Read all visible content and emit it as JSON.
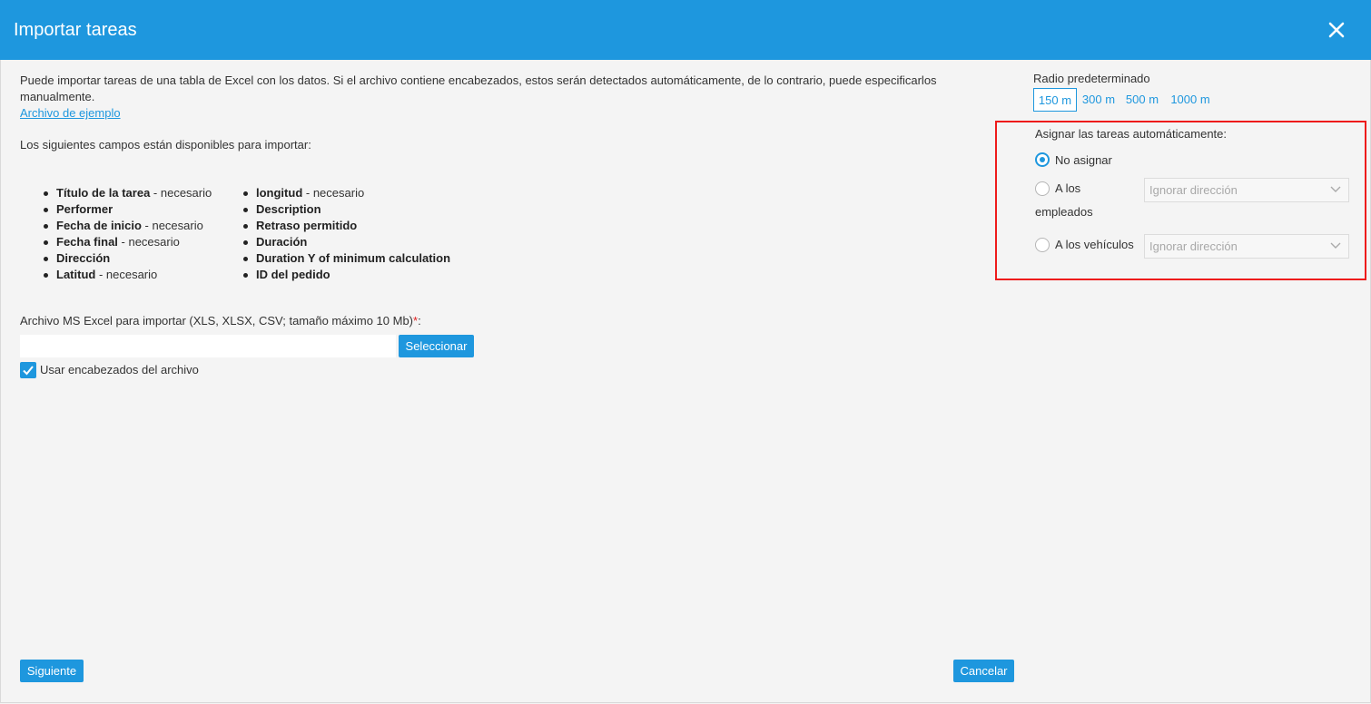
{
  "dialog": {
    "title": "Importar tareas"
  },
  "intro": {
    "text": "Puede importar tareas de una tabla de Excel con los datos. Si el archivo contiene encabezados, estos serán detectados automáticamente, de lo contrario, puede especificarlos manualmente.",
    "example_link": "Archivo de ejemplo"
  },
  "fields_title": "Los siguientes campos están disponibles para importar:",
  "fields": {
    "col1": [
      {
        "name": "Título de la tarea",
        "note": " - necesario"
      },
      {
        "name": "Performer",
        "note": ""
      },
      {
        "name": "Fecha de inicio",
        "note": " - necesario"
      },
      {
        "name": "Fecha final",
        "note": " - necesario"
      },
      {
        "name": "Dirección",
        "note": ""
      },
      {
        "name": "Latitud",
        "note": " - necesario"
      }
    ],
    "col2": [
      {
        "name": "longitud",
        "note": " - necesario"
      },
      {
        "name": "Description",
        "note": ""
      },
      {
        "name": "Retraso permitido",
        "note": ""
      },
      {
        "name": "Duración",
        "note": ""
      },
      {
        "name": "Duration Y of minimum calculation",
        "note": ""
      },
      {
        "name": "ID del pedido",
        "note": ""
      }
    ]
  },
  "file": {
    "label": "Archivo MS Excel para importar (XLS, XLSX, CSV; tamaño máximo 10 Mb)",
    "required_mark": "*",
    "label_suffix": ":",
    "value": "",
    "select_button": "Seleccionar"
  },
  "use_headers": {
    "label": "Usar encabezados del archivo",
    "checked": true
  },
  "radius": {
    "label": "Radio predeterminado",
    "options": [
      "150 m",
      "300 m",
      "500 m",
      "1000 m"
    ],
    "selected": "150 m"
  },
  "assign": {
    "title": "Asignar las tareas automáticamente:",
    "options": {
      "none": "No asignar",
      "employees_line1": "A los",
      "employees_line2": "empleados",
      "vehicles": "A los vehículos"
    },
    "selected": "none",
    "employees_select": "Ignorar dirección",
    "vehicles_select": "Ignorar dirección"
  },
  "footer": {
    "next": "Siguiente",
    "cancel": "Cancelar"
  },
  "colors": {
    "accent": "#1e97de",
    "highlight": "#ee1b1b"
  }
}
